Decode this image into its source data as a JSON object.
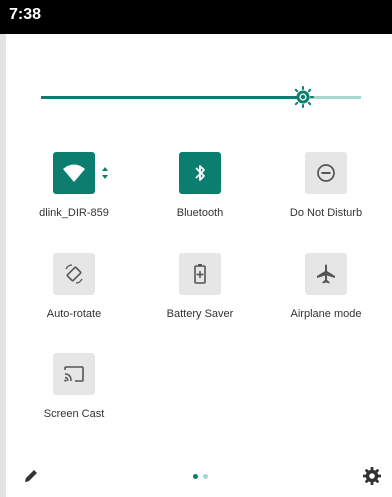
{
  "status_bar": {
    "time": "7:38"
  },
  "brightness": {
    "level": 0.82
  },
  "tiles": [
    {
      "label": "dlink_DIR-859",
      "icon": "wifi-icon",
      "active": true
    },
    {
      "label": "Bluetooth",
      "icon": "bluetooth-icon",
      "active": true
    },
    {
      "label": "Do Not Disturb",
      "icon": "do-not-disturb-icon",
      "active": false
    },
    {
      "label": "Auto-rotate",
      "icon": "auto-rotate-icon",
      "active": false
    },
    {
      "label": "Battery Saver",
      "icon": "battery-saver-icon",
      "active": false
    },
    {
      "label": "Airplane mode",
      "icon": "airplane-icon",
      "active": false
    },
    {
      "label": "Screen Cast",
      "icon": "cast-icon",
      "active": false
    }
  ],
  "pager": {
    "pages": 2,
    "current": 1
  },
  "colors": {
    "accent": "#0b7e6f",
    "accent_light": "#a6d6cf",
    "tile_inactive": "#e6e6e6",
    "icon_inactive": "#555555"
  },
  "footer": {
    "left_icon": "edit-icon",
    "right_icon": "gear-icon"
  }
}
